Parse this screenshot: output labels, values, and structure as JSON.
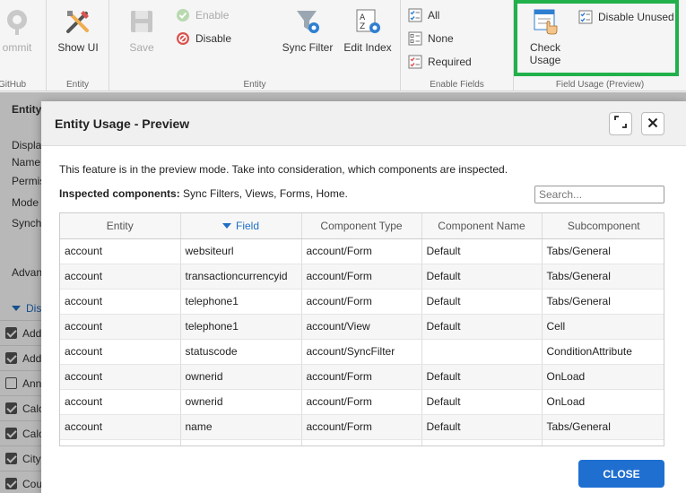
{
  "ribbon": {
    "github": {
      "commit_label": "ommit",
      "group_label": "GitHub"
    },
    "entity_group1": {
      "show_ui_label": "Show UI",
      "group_label": "Entity"
    },
    "entity_group2": {
      "save_label": "Save",
      "enable_label": "Enable",
      "disable_label": "Disable",
      "sync_filter_label": "Sync Filter",
      "edit_index_label": "Edit Index",
      "group_label": "Entity"
    },
    "enable_fields": {
      "all_label": "All",
      "none_label": "None",
      "required_label": "Required",
      "group_label": "Enable Fields"
    },
    "field_usage": {
      "check_usage_label_line1": "Check",
      "check_usage_label_line2": "Usage",
      "disable_unused_label": "Disable Unused",
      "group_label": "Field Usage (Preview)"
    }
  },
  "background": {
    "entity_tab": "Entity",
    "labels": [
      "Displa",
      "Name",
      "Permis",
      "Mode",
      "Synch"
    ],
    "advanced": "Advan",
    "section": "Dis",
    "rows": [
      {
        "label": "Add",
        "checked": true
      },
      {
        "label": "Add",
        "checked": true
      },
      {
        "label": "Ann",
        "checked": false
      },
      {
        "label": "Calc",
        "checked": true
      },
      {
        "label": "Calc",
        "checked": true
      },
      {
        "label": "City",
        "checked": true
      },
      {
        "label": "Cou",
        "checked": true
      }
    ]
  },
  "dialog": {
    "title": "Entity Usage - Preview",
    "note": "This feature is in the preview mode. Take into consideration, which components are inspected.",
    "inspected_label": "Inspected components:",
    "inspected_value": " Sync Filters, Views, Forms, Home.",
    "search_placeholder": "Search...",
    "columns": [
      "Entity",
      "Field",
      "Component Type",
      "Component Name",
      "Subcomponent"
    ],
    "rows": [
      [
        "account",
        "websiteurl",
        "account/Form",
        "Default",
        "Tabs/General"
      ],
      [
        "account",
        "transactioncurrencyid",
        "account/Form",
        "Default",
        "Tabs/General"
      ],
      [
        "account",
        "telephone1",
        "account/Form",
        "Default",
        "Tabs/General"
      ],
      [
        "account",
        "telephone1",
        "account/View",
        "Default",
        "Cell"
      ],
      [
        "account",
        "statuscode",
        "account/SyncFilter",
        "",
        "ConditionAttribute"
      ],
      [
        "account",
        "ownerid",
        "account/Form",
        "Default",
        "OnLoad"
      ],
      [
        "account",
        "ownerid",
        "account/Form",
        "Default",
        "OnLoad"
      ],
      [
        "account",
        "name",
        "account/Form",
        "Default",
        "Tabs/General"
      ],
      [
        "account",
        "",
        "account/View",
        "Default",
        "Cell"
      ]
    ],
    "close_label": "CLOSE"
  }
}
